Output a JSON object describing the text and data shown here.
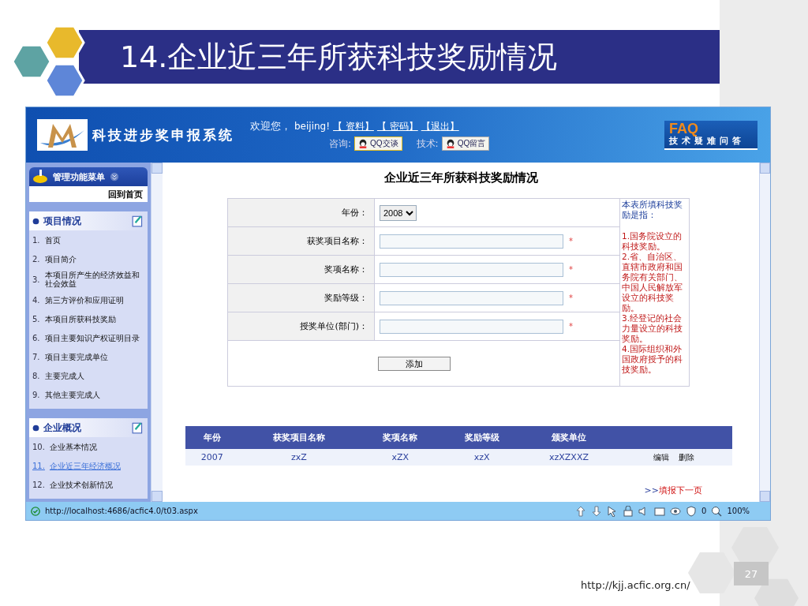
{
  "slide": {
    "title": "14.企业近三年所获科技奖励情况",
    "url": "http://kjj.acfic.org.cn/",
    "page_number": "27"
  },
  "header": {
    "system_name": "科技进步奖申报系统",
    "welcome": "欢迎您，",
    "user": "beijing!",
    "links": [
      "【 资料】",
      "【 密码】",
      "【退出】"
    ],
    "consult_label": "咨询:",
    "consult_button": "QQ交谈",
    "tech_label": "技术:",
    "tech_button": "QQ留言",
    "faq": "FAQ",
    "faq_subtitle": "技术疑难问答"
  },
  "sidebar": {
    "menu_title": "管理功能菜单",
    "home": "回到首页",
    "sections": [
      {
        "title": "项目情况",
        "items": [
          {
            "number": "1.",
            "label": "首页",
            "selected": false
          },
          {
            "number": "2.",
            "label": "项目简介",
            "selected": false
          },
          {
            "number": "3.",
            "label": "本项目所产生的经济效益和社会效益",
            "selected": false
          },
          {
            "number": "4.",
            "label": "第三方评价和应用证明",
            "selected": false
          },
          {
            "number": "5.",
            "label": "本项目所获科技奖励",
            "selected": false
          },
          {
            "number": "6.",
            "label": "项目主要知识产权证明目录",
            "selected": false
          },
          {
            "number": "7.",
            "label": "项目主要完成单位",
            "selected": false
          },
          {
            "number": "8.",
            "label": "主要完成人",
            "selected": false
          },
          {
            "number": "9.",
            "label": "其他主要完成人",
            "selected": false
          }
        ]
      },
      {
        "title": "企业概况",
        "items": [
          {
            "number": "10.",
            "label": "企业基本情况",
            "selected": false
          },
          {
            "number": "11.",
            "label": "企业近三年经济概况",
            "selected": true
          },
          {
            "number": "12.",
            "label": "企业技术创新情况",
            "selected": false
          }
        ]
      }
    ]
  },
  "form": {
    "title": "企业近三年所获科技奖励情况",
    "fields": [
      {
        "label": "年份：",
        "kind": "select",
        "value": "2008",
        "required": false
      },
      {
        "label": "获奖项目名称：",
        "kind": "text",
        "required": true
      },
      {
        "label": "奖项名称：",
        "kind": "text",
        "required": true
      },
      {
        "label": "奖励等级：",
        "kind": "text",
        "required": true
      },
      {
        "label": "授奖单位(部门)：",
        "kind": "text",
        "required": true
      }
    ],
    "required_mark": "*",
    "submit": "添加",
    "note": {
      "heading": "本表所填科技奖励是指：",
      "items": [
        "1.国务院设立的科技奖励。",
        "2.省、自治区、直辖市政府和国务院有关部门、中国人民解放军设立的科技奖励。",
        "3.经登记的社会力量设立的科技奖励。",
        "4.国际组织和外国政府授予的科技奖励。"
      ]
    }
  },
  "table": {
    "columns": [
      "年份",
      "获奖项目名称",
      "奖项名称",
      "奖励等级",
      "颁奖单位"
    ],
    "rows": [
      {
        "cells": [
          "2007",
          "zxZ",
          "xZX",
          "xzX",
          "xzXZXXZ"
        ],
        "actions": [
          "编辑",
          "删除"
        ]
      }
    ]
  },
  "next_link": {
    "arrows": ">>",
    "label": "填报下一页"
  },
  "status_bar": {
    "url": "http://localhost:4686/acfic4.0/t03.aspx",
    "count": "0",
    "zoom": "100%"
  }
}
